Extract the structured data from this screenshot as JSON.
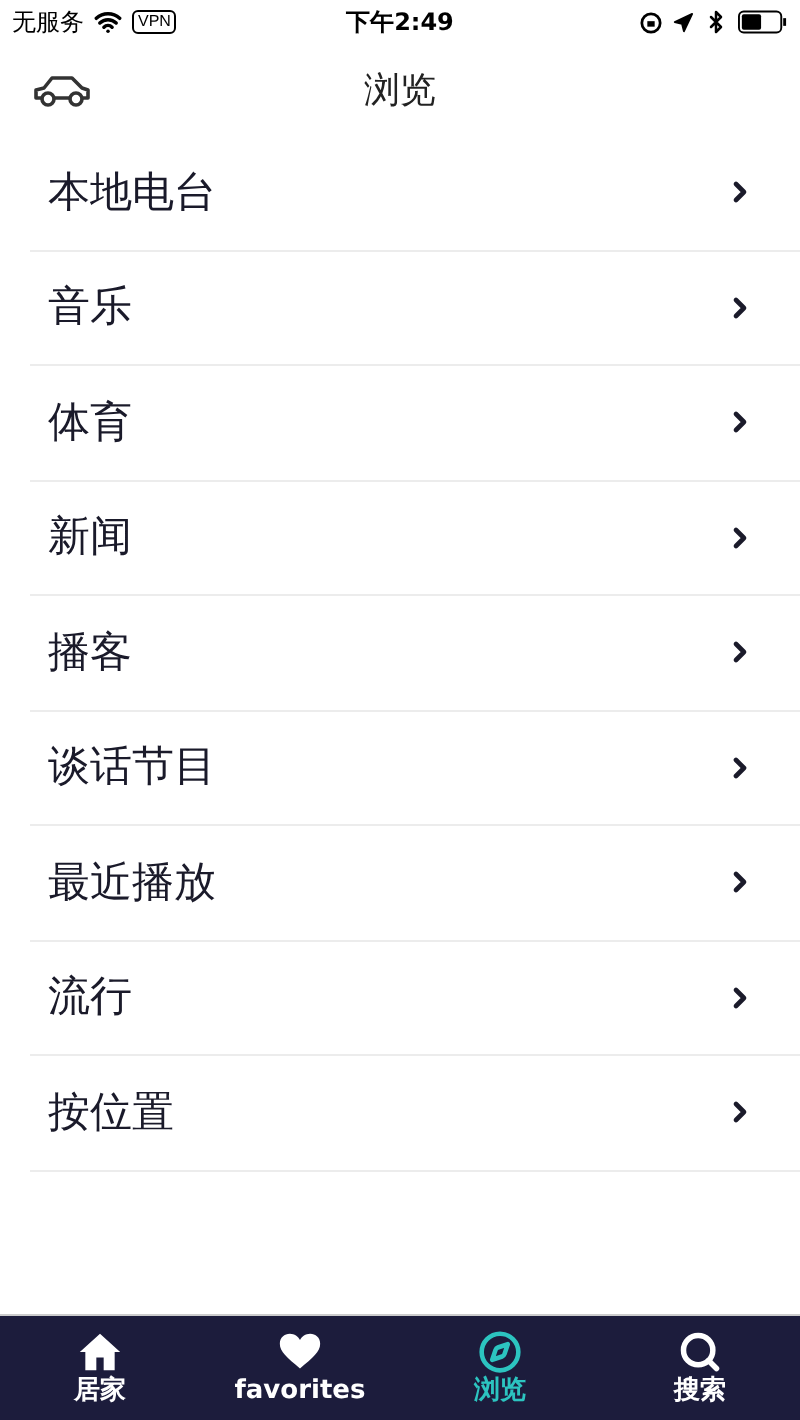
{
  "status_bar": {
    "carrier": "无服务",
    "vpn": "VPN",
    "time": "下午2:49"
  },
  "header": {
    "title": "浏览"
  },
  "items": [
    {
      "label": "本地电台"
    },
    {
      "label": "音乐"
    },
    {
      "label": "体育"
    },
    {
      "label": "新闻"
    },
    {
      "label": "播客"
    },
    {
      "label": "谈话节目"
    },
    {
      "label": "最近播放"
    },
    {
      "label": "流行"
    },
    {
      "label": "按位置"
    }
  ],
  "tab_bar": [
    {
      "label": "居家",
      "selected": false
    },
    {
      "label": "favorites",
      "selected": false
    },
    {
      "label": "浏览",
      "selected": true
    },
    {
      "label": "搜索",
      "selected": false
    }
  ]
}
